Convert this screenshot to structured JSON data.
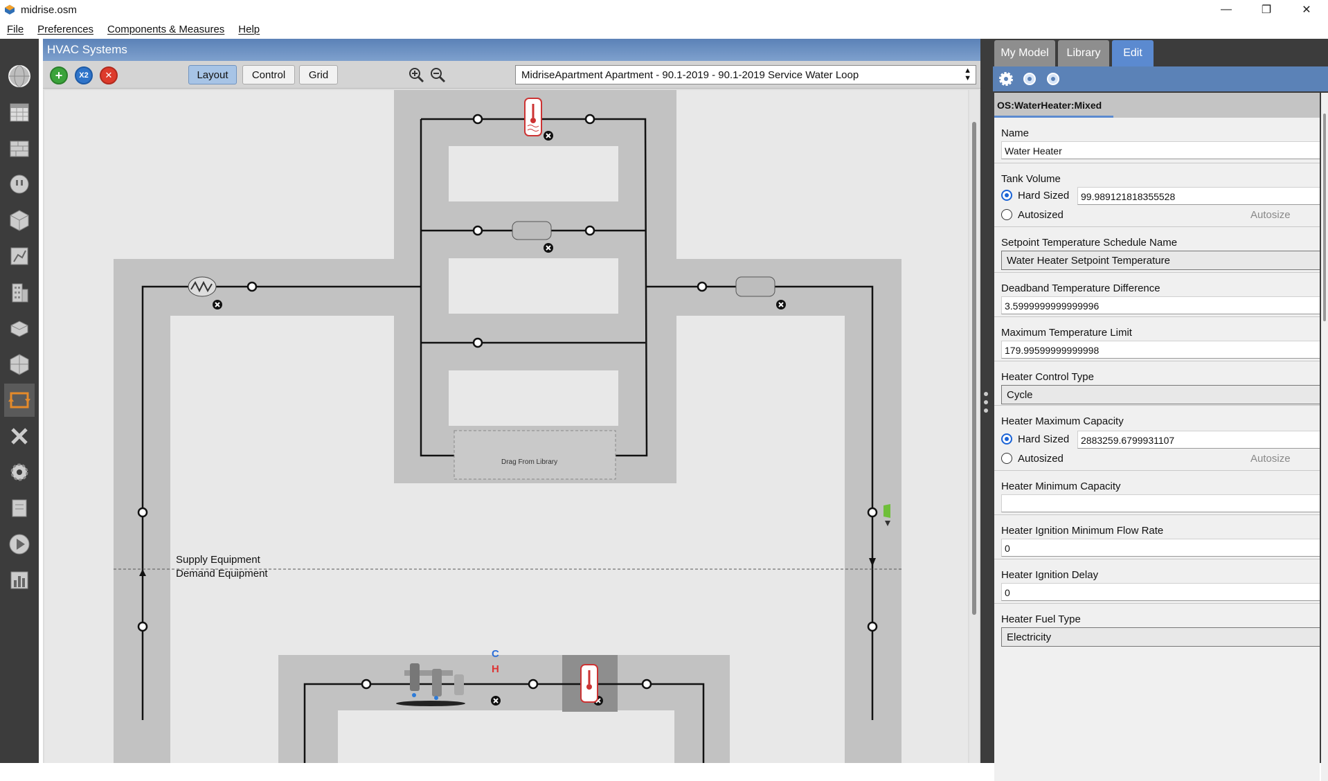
{
  "window": {
    "title": "midrise.osm",
    "minimize": "—",
    "maximize": "❐",
    "close": "✕"
  },
  "menu": {
    "file": "File",
    "preferences": "Preferences",
    "components": "Components & Measures",
    "help": "Help"
  },
  "hvac": {
    "header": "HVAC Systems",
    "toolbar": {
      "add": "+",
      "copy": "X2",
      "delete": "✕",
      "layout": "Layout",
      "control": "Control",
      "grid": "Grid",
      "loop_selected": "MidriseApartment Apartment - 90.1-2019 - 90.1-2019 Service Water Loop"
    },
    "canvas": {
      "drag_from_library": "Drag From Library",
      "supply_equipment": "Supply Equipment",
      "demand_equipment": "Demand Equipment",
      "faucet_c": "C",
      "faucet_h": "H"
    }
  },
  "right_panel": {
    "tabs": [
      "My Model",
      "Library",
      "Edit"
    ],
    "object_type": "OS:WaterHeater:Mixed",
    "fields": {
      "name": {
        "label": "Name",
        "value": "Water Heater"
      },
      "tank_volume": {
        "label": "Tank Volume",
        "hard_sized": "Hard Sized",
        "value": "99.989121818355528",
        "autosized": "Autosized",
        "autosize_btn": "Autosize"
      },
      "setpoint": {
        "label": "Setpoint Temperature Schedule Name",
        "value": "Water Heater Setpoint Temperature"
      },
      "deadband": {
        "label": "Deadband Temperature Difference",
        "value": "3.5999999999999996"
      },
      "max_temp": {
        "label": "Maximum Temperature Limit",
        "value": "179.99599999999998"
      },
      "control_type": {
        "label": "Heater Control Type",
        "value": "Cycle"
      },
      "max_capacity": {
        "label": "Heater Maximum Capacity",
        "hard_sized": "Hard Sized",
        "value": "2883259.6799931107",
        "autosized": "Autosized",
        "autosize_btn": "Autosize"
      },
      "min_capacity": {
        "label": "Heater Minimum Capacity",
        "value": ""
      },
      "ignition_flow": {
        "label": "Heater Ignition Minimum Flow Rate",
        "value": "0"
      },
      "ignition_delay": {
        "label": "Heater Ignition Delay",
        "value": "0"
      },
      "fuel_type": {
        "label": "Heater Fuel Type",
        "value": "Electricity"
      }
    }
  }
}
